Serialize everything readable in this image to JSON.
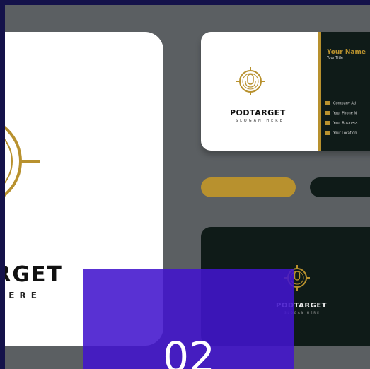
{
  "image": {
    "brand_name": "PODTARGET",
    "tagline": "SLOGAN HERE",
    "big_card": {
      "word_visible": "ARGET",
      "tag_visible": "N HERE"
    },
    "front_card": {
      "name": "Your Name",
      "title": "Your Title",
      "contacts": [
        "Company Ad",
        "Your Phone N",
        "Your Business",
        "Your Location"
      ]
    },
    "back_card": {
      "brand_name": "PODTARGET",
      "tagline": "SLOGAN HERE"
    }
  },
  "overlay": {
    "number": "02"
  },
  "colors": {
    "frame": "#14124a",
    "background": "#5b5f62",
    "gold": "#b8912e",
    "dark_green": "#0f1b18",
    "overlay": "#4214cd"
  }
}
